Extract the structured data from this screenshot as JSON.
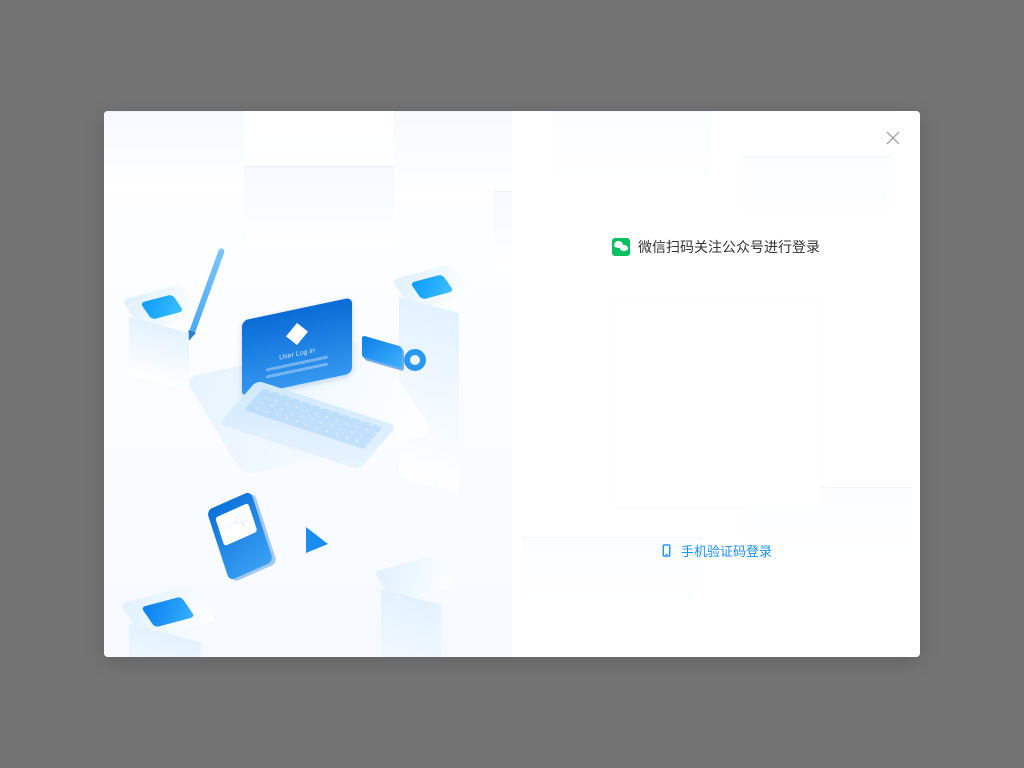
{
  "login": {
    "title": "微信扫码关注公众号进行登录",
    "alt_method": "手机验证码登录",
    "laptop_label": "User Log in"
  },
  "icons": {
    "wechat": "wechat-icon",
    "phone": "phone-icon",
    "close": "close-icon"
  },
  "colors": {
    "accent": "#1890ff",
    "wechat_green": "#07c160"
  }
}
